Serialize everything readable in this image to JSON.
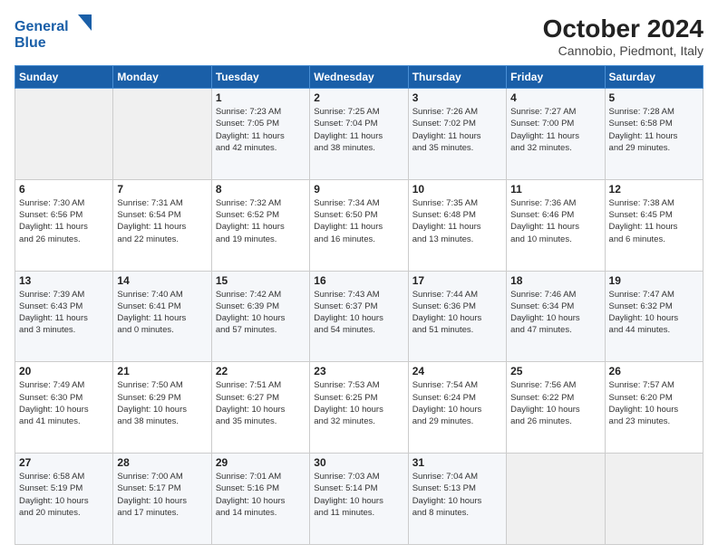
{
  "header": {
    "logo_line1": "General",
    "logo_line2": "Blue",
    "month": "October 2024",
    "location": "Cannobio, Piedmont, Italy"
  },
  "weekdays": [
    "Sunday",
    "Monday",
    "Tuesday",
    "Wednesday",
    "Thursday",
    "Friday",
    "Saturday"
  ],
  "weeks": [
    [
      {
        "day": "",
        "info": ""
      },
      {
        "day": "",
        "info": ""
      },
      {
        "day": "1",
        "info": "Sunrise: 7:23 AM\nSunset: 7:05 PM\nDaylight: 11 hours\nand 42 minutes."
      },
      {
        "day": "2",
        "info": "Sunrise: 7:25 AM\nSunset: 7:04 PM\nDaylight: 11 hours\nand 38 minutes."
      },
      {
        "day": "3",
        "info": "Sunrise: 7:26 AM\nSunset: 7:02 PM\nDaylight: 11 hours\nand 35 minutes."
      },
      {
        "day": "4",
        "info": "Sunrise: 7:27 AM\nSunset: 7:00 PM\nDaylight: 11 hours\nand 32 minutes."
      },
      {
        "day": "5",
        "info": "Sunrise: 7:28 AM\nSunset: 6:58 PM\nDaylight: 11 hours\nand 29 minutes."
      }
    ],
    [
      {
        "day": "6",
        "info": "Sunrise: 7:30 AM\nSunset: 6:56 PM\nDaylight: 11 hours\nand 26 minutes."
      },
      {
        "day": "7",
        "info": "Sunrise: 7:31 AM\nSunset: 6:54 PM\nDaylight: 11 hours\nand 22 minutes."
      },
      {
        "day": "8",
        "info": "Sunrise: 7:32 AM\nSunset: 6:52 PM\nDaylight: 11 hours\nand 19 minutes."
      },
      {
        "day": "9",
        "info": "Sunrise: 7:34 AM\nSunset: 6:50 PM\nDaylight: 11 hours\nand 16 minutes."
      },
      {
        "day": "10",
        "info": "Sunrise: 7:35 AM\nSunset: 6:48 PM\nDaylight: 11 hours\nand 13 minutes."
      },
      {
        "day": "11",
        "info": "Sunrise: 7:36 AM\nSunset: 6:46 PM\nDaylight: 11 hours\nand 10 minutes."
      },
      {
        "day": "12",
        "info": "Sunrise: 7:38 AM\nSunset: 6:45 PM\nDaylight: 11 hours\nand 6 minutes."
      }
    ],
    [
      {
        "day": "13",
        "info": "Sunrise: 7:39 AM\nSunset: 6:43 PM\nDaylight: 11 hours\nand 3 minutes."
      },
      {
        "day": "14",
        "info": "Sunrise: 7:40 AM\nSunset: 6:41 PM\nDaylight: 11 hours\nand 0 minutes."
      },
      {
        "day": "15",
        "info": "Sunrise: 7:42 AM\nSunset: 6:39 PM\nDaylight: 10 hours\nand 57 minutes."
      },
      {
        "day": "16",
        "info": "Sunrise: 7:43 AM\nSunset: 6:37 PM\nDaylight: 10 hours\nand 54 minutes."
      },
      {
        "day": "17",
        "info": "Sunrise: 7:44 AM\nSunset: 6:36 PM\nDaylight: 10 hours\nand 51 minutes."
      },
      {
        "day": "18",
        "info": "Sunrise: 7:46 AM\nSunset: 6:34 PM\nDaylight: 10 hours\nand 47 minutes."
      },
      {
        "day": "19",
        "info": "Sunrise: 7:47 AM\nSunset: 6:32 PM\nDaylight: 10 hours\nand 44 minutes."
      }
    ],
    [
      {
        "day": "20",
        "info": "Sunrise: 7:49 AM\nSunset: 6:30 PM\nDaylight: 10 hours\nand 41 minutes."
      },
      {
        "day": "21",
        "info": "Sunrise: 7:50 AM\nSunset: 6:29 PM\nDaylight: 10 hours\nand 38 minutes."
      },
      {
        "day": "22",
        "info": "Sunrise: 7:51 AM\nSunset: 6:27 PM\nDaylight: 10 hours\nand 35 minutes."
      },
      {
        "day": "23",
        "info": "Sunrise: 7:53 AM\nSunset: 6:25 PM\nDaylight: 10 hours\nand 32 minutes."
      },
      {
        "day": "24",
        "info": "Sunrise: 7:54 AM\nSunset: 6:24 PM\nDaylight: 10 hours\nand 29 minutes."
      },
      {
        "day": "25",
        "info": "Sunrise: 7:56 AM\nSunset: 6:22 PM\nDaylight: 10 hours\nand 26 minutes."
      },
      {
        "day": "26",
        "info": "Sunrise: 7:57 AM\nSunset: 6:20 PM\nDaylight: 10 hours\nand 23 minutes."
      }
    ],
    [
      {
        "day": "27",
        "info": "Sunrise: 6:58 AM\nSunset: 5:19 PM\nDaylight: 10 hours\nand 20 minutes."
      },
      {
        "day": "28",
        "info": "Sunrise: 7:00 AM\nSunset: 5:17 PM\nDaylight: 10 hours\nand 17 minutes."
      },
      {
        "day": "29",
        "info": "Sunrise: 7:01 AM\nSunset: 5:16 PM\nDaylight: 10 hours\nand 14 minutes."
      },
      {
        "day": "30",
        "info": "Sunrise: 7:03 AM\nSunset: 5:14 PM\nDaylight: 10 hours\nand 11 minutes."
      },
      {
        "day": "31",
        "info": "Sunrise: 7:04 AM\nSunset: 5:13 PM\nDaylight: 10 hours\nand 8 minutes."
      },
      {
        "day": "",
        "info": ""
      },
      {
        "day": "",
        "info": ""
      }
    ]
  ]
}
